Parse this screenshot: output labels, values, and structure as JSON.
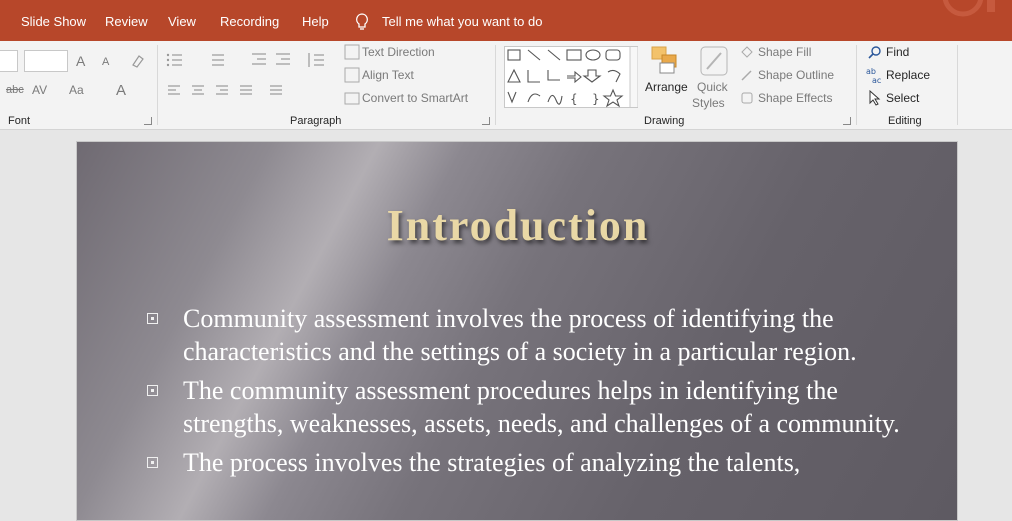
{
  "menu": {
    "items": [
      "Slide Show",
      "Review",
      "View",
      "Recording",
      "Help"
    ],
    "tell_me": "Tell me what you want to do"
  },
  "ribbon": {
    "font_group": "Font",
    "paragraph_group": "Paragraph",
    "drawing_group": "Drawing",
    "editing_group": "Editing",
    "text_direction": "Text Direction",
    "align_text": "Align Text",
    "convert_smartart": "Convert to SmartArt",
    "arrange": "Arrange",
    "quick": "Quick",
    "styles": "Styles",
    "shape_fill": "Shape Fill",
    "shape_outline": "Shape Outline",
    "shape_effects": "Shape Effects",
    "find": "Find",
    "replace": "Replace",
    "select": "Select",
    "font_size_glyph": "A",
    "aa_glyph": "Aa",
    "abc_glyph": "abc",
    "av_glyph": "AV"
  },
  "slide": {
    "title": "Introduction",
    "bullets": [
      "Community assessment involves the process of identifying the characteristics and the settings of a society in a particular region.",
      "The community assessment procedures helps in identifying the strengths, weaknesses, assets, needs, and challenges of a community.",
      "The process involves the strategies of analyzing the talents,"
    ]
  },
  "colors": {
    "menubar": "#b7472a",
    "title_gold": "#e9d8a6"
  }
}
